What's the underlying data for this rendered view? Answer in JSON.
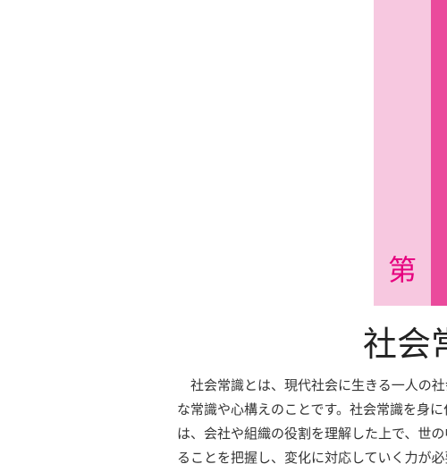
{
  "chapter": {
    "label": "第"
  },
  "section": {
    "title": "社会常"
  },
  "body": {
    "lines": [
      "　社会常識とは、現代社会に生きる一人の社会人と",
      "な常識や心構えのことです。社会常識を身に付け",
      "は、会社や組織の役割を理解した上で、世の中で",
      "ることを把握し、変化に対応していく力が必要です"
    ]
  },
  "colors": {
    "chapter_band": "#f7c8e0",
    "chapter_bar": "#ea4a9c",
    "chapter_label": "#e6007e"
  }
}
